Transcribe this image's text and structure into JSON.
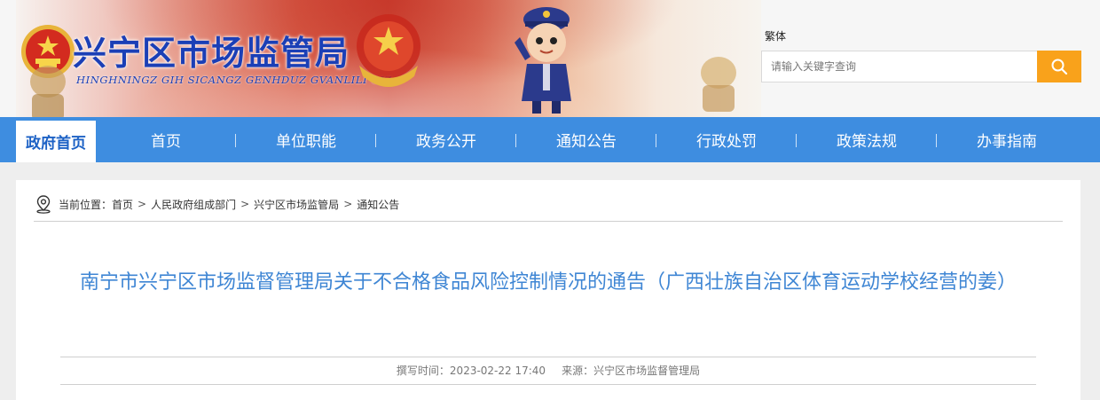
{
  "header": {
    "site_title": "兴宁区市场监管局",
    "site_pinyin": "HINGHNINGZ GIH SICANGZ GENHDUZ GVANLILI GIZ",
    "traditional_link": "繁体",
    "search": {
      "placeholder": "请输入关键字查询"
    }
  },
  "nav": {
    "home": "政府首页",
    "items": [
      "首页",
      "单位职能",
      "政务公开",
      "通知公告",
      "行政处罚",
      "政策法规",
      "办事指南"
    ]
  },
  "breadcrumb": {
    "label": "当前位置：",
    "items": [
      "首页",
      "人民政府组成部门",
      "兴宁区市场监管局",
      "通知公告"
    ],
    "separator": ">"
  },
  "article": {
    "title": "南宁市兴宁区市场监督管理局关于不合格食品风险控制情况的通告（广西壮族自治区体育运动学校经营的姜）",
    "written_label": "撰写时间：",
    "written_time": "2023-02-22 17:40",
    "source_label": "来源：",
    "source": "兴宁区市场监督管理局"
  },
  "colors": {
    "nav_bg": "#3e8de0",
    "title_blue": "#3f86d4",
    "search_btn": "#f9a21b",
    "site_title": "#1b3fb6"
  }
}
